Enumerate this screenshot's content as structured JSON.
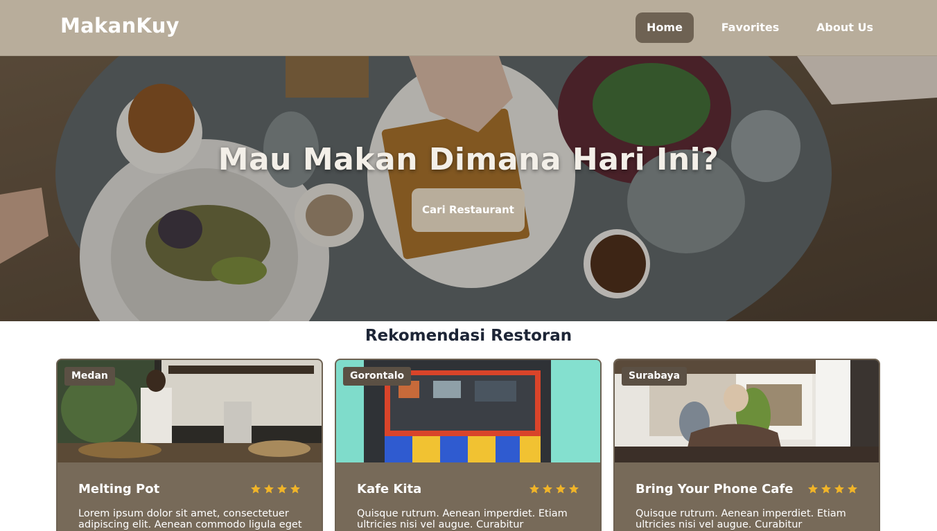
{
  "header": {
    "brand": "MakanKuy",
    "nav": [
      {
        "label": "Home",
        "active": true
      },
      {
        "label": "Favorites",
        "active": false
      },
      {
        "label": "About Us",
        "active": false
      }
    ]
  },
  "hero": {
    "title": "Mau Makan Dimana Hari Ini?",
    "button_label": "Cari Restaurant"
  },
  "section": {
    "title": "Rekomendasi Restoran"
  },
  "restaurants": [
    {
      "city": "Medan",
      "name": "Melting Pot",
      "rating_stars": 4,
      "description": "Lorem ipsum dolor sit amet, consectetuer adipiscing elit. Aenean commodo ligula eget"
    },
    {
      "city": "Gorontalo",
      "name": "Kafe Kita",
      "rating_stars": 4,
      "description": "Quisque rutrum. Aenean imperdiet. Etiam ultricies nisi vel augue. Curabitur"
    },
    {
      "city": "Surabaya",
      "name": "Bring Your Phone Cafe",
      "rating_stars": 4,
      "description": "Quisque rutrum. Aenean imperdiet. Etiam ultricies nisi vel augue. Curabitur"
    }
  ],
  "colors": {
    "navbar": "#b8ad9b",
    "nav_active": "#6e6253",
    "card_body": "#776a59",
    "star": "#f0b429"
  },
  "icons": [
    "star-icon"
  ]
}
